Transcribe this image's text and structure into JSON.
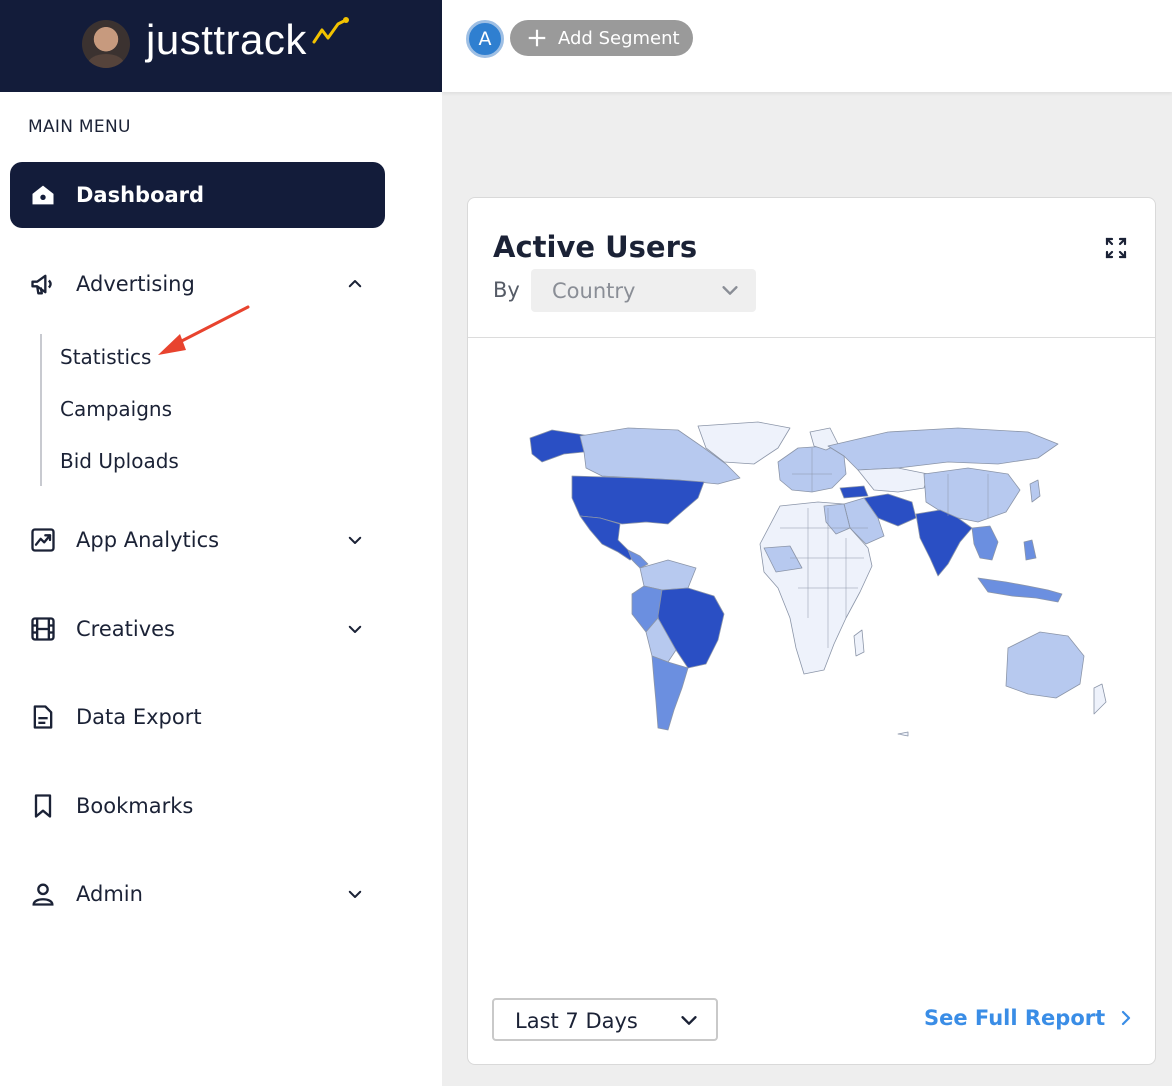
{
  "brand": {
    "name": "justtrack",
    "avatar_icon": "user-avatar"
  },
  "sidebar": {
    "menu_title": "MAIN MENU",
    "items": [
      {
        "label": "Dashboard",
        "icon": "home-icon",
        "active": true
      },
      {
        "label": "Advertising",
        "icon": "megaphone-icon",
        "expanded": true,
        "children": [
          "Statistics",
          "Campaigns",
          "Bid Uploads"
        ]
      },
      {
        "label": "App Analytics",
        "icon": "chart-icon"
      },
      {
        "label": "Creatives",
        "icon": "film-icon"
      },
      {
        "label": "Data Export",
        "icon": "document-icon"
      },
      {
        "label": "Bookmarks",
        "icon": "bookmark-icon"
      },
      {
        "label": "Admin",
        "icon": "user-icon"
      }
    ]
  },
  "topbar": {
    "segment_letter": "A",
    "add_segment_label": "Add Segment"
  },
  "card": {
    "title": "Active Users",
    "by_label": "By",
    "dimension_value": "Country",
    "range_value": "Last 7 Days",
    "report_link": "See Full Report"
  },
  "colors": {
    "navy": "#131c3a",
    "accent_blue": "#3a8de6",
    "map_high": "#2a4fc4",
    "map_mid": "#6b8fe0",
    "map_low": "#b7c9ef",
    "map_lowest": "#eef2fb",
    "annotation_arrow": "#e8432e"
  }
}
